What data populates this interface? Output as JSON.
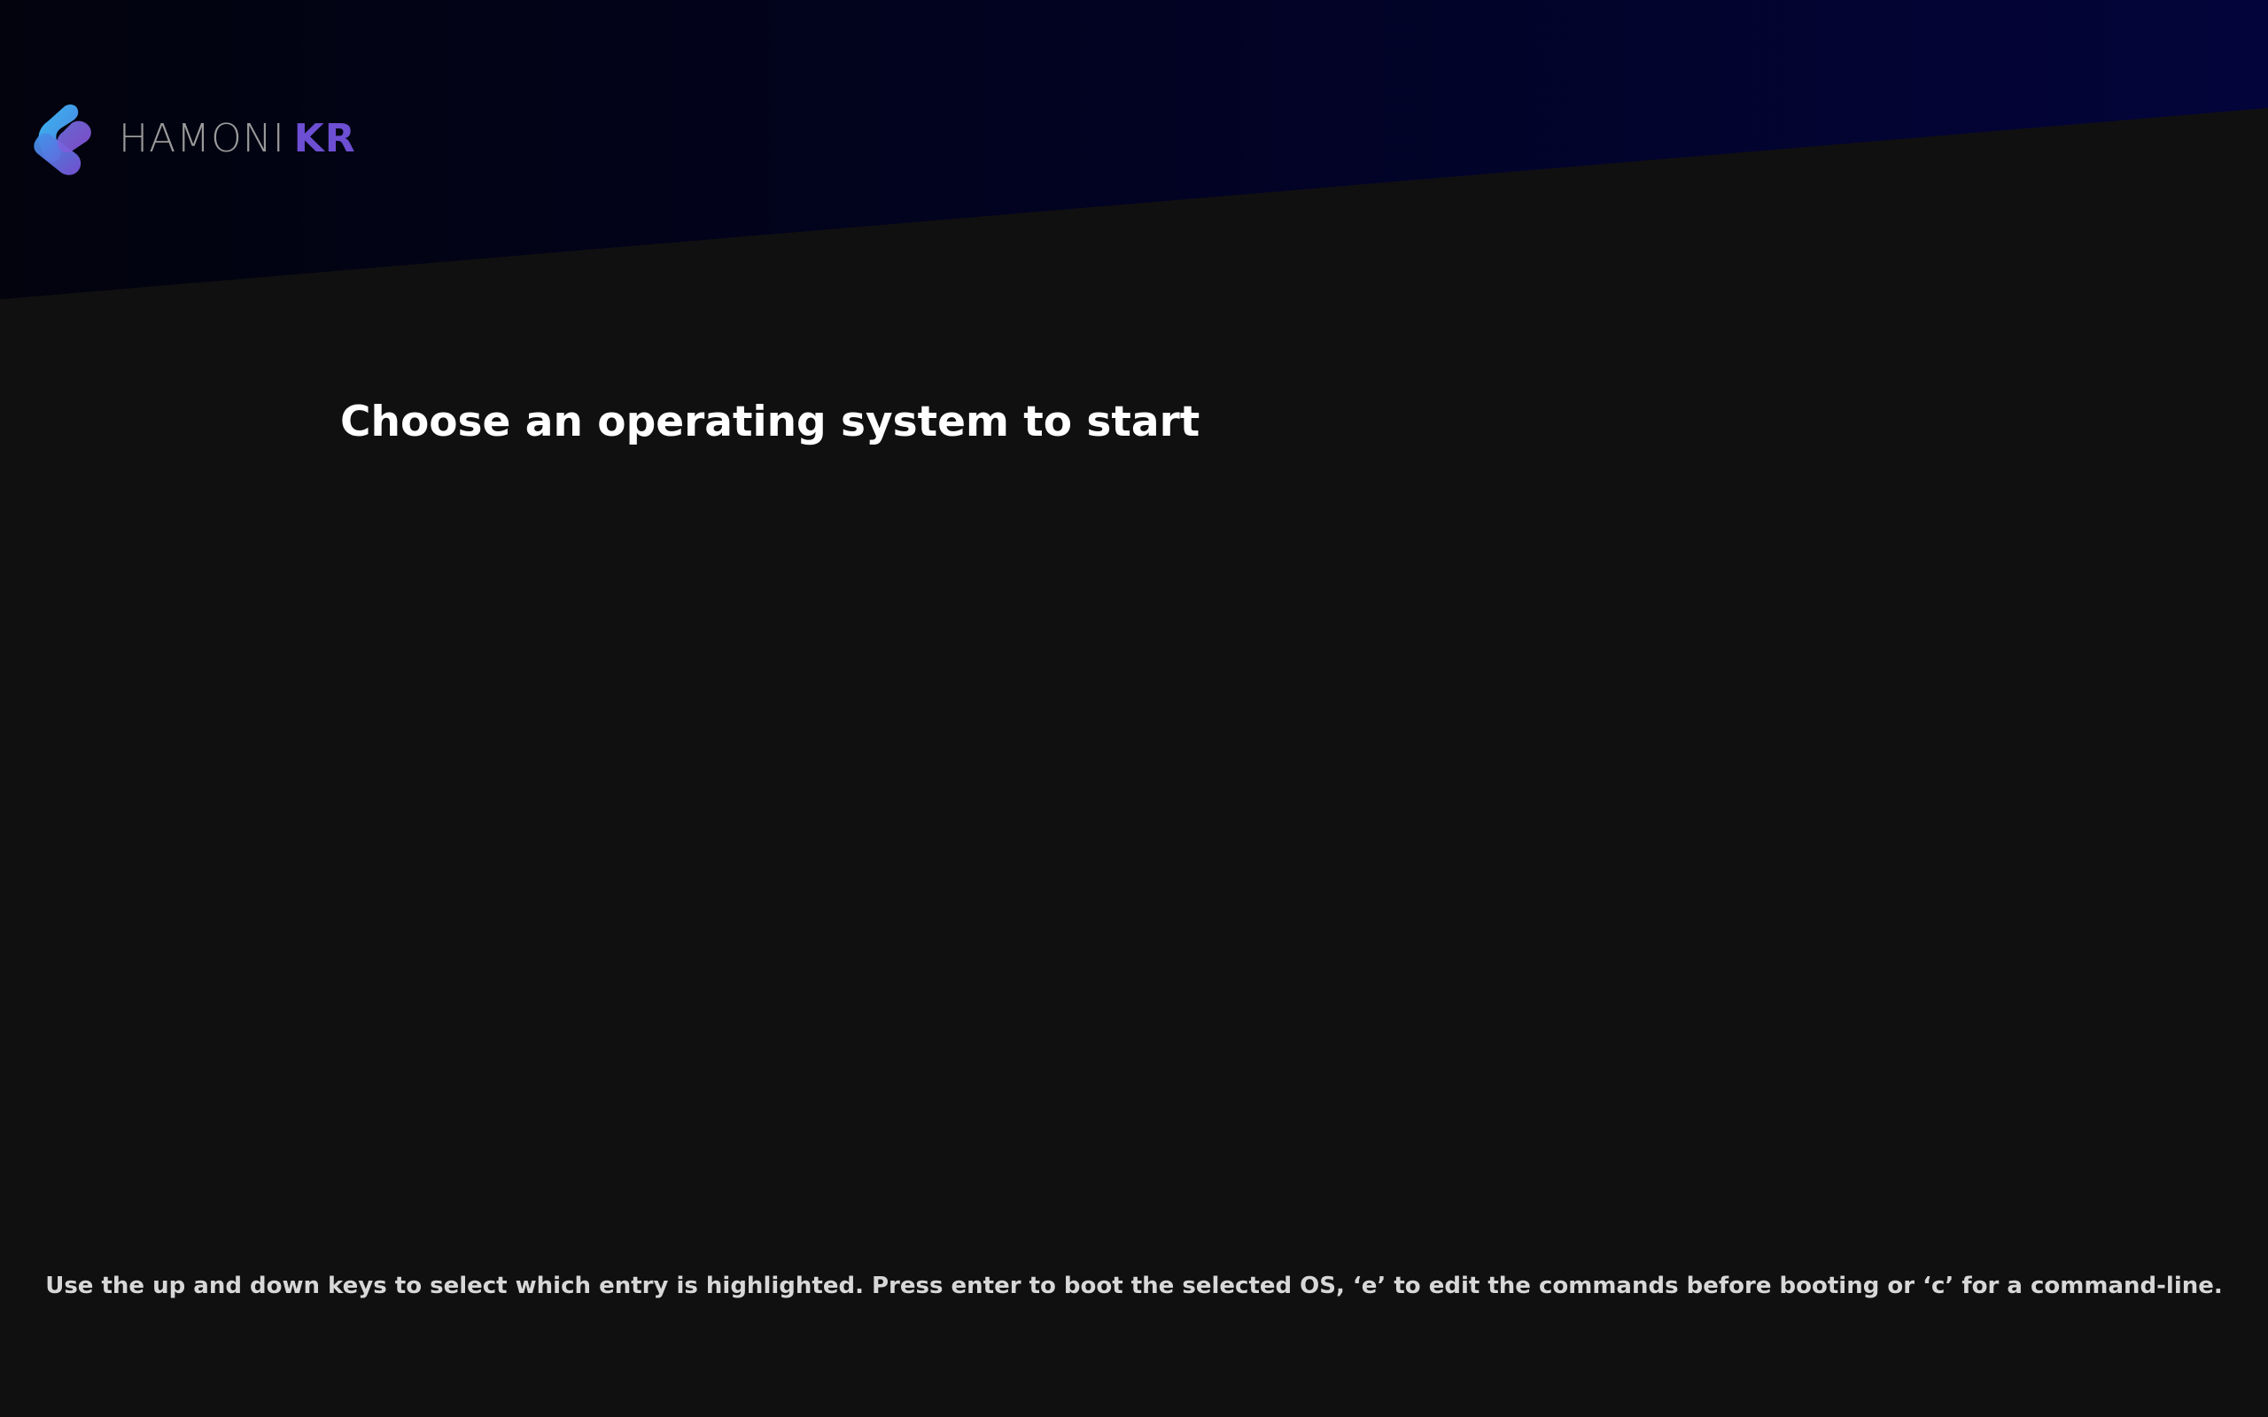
{
  "window": {
    "title": "Choose an operating system to start"
  },
  "brand": {
    "main": "HAMONI",
    "accent": "KR",
    "logo_icon": "hamonikr-logo-icon"
  },
  "boot_menu": {
    "title": "Choose an operating system to start",
    "entries": []
  },
  "help": {
    "text": "Use the up and down keys to select which entry is highlighted. Press enter to boot the selected OS, ‘e’ to edit the commands before booting or ‘c’ for a command-line."
  },
  "colors": {
    "background": "#111010",
    "header_left": "#02030d",
    "header_right": "#03043a",
    "title": "#ffffff",
    "help_text": "#d7d7d7",
    "brand_main": "#9a9a9a",
    "brand_accent": "#6d4fd3",
    "logo_blue": "#3ca8ea",
    "logo_purple": "#7b52d8"
  }
}
